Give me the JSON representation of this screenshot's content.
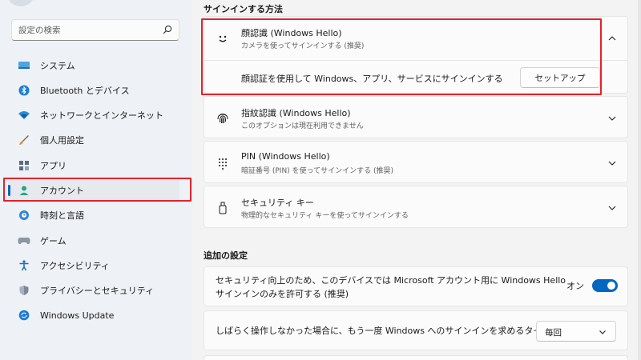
{
  "sidebar": {
    "search_placeholder": "設定の検索",
    "items": [
      {
        "label": "システム",
        "icon": "monitor-icon"
      },
      {
        "label": "Bluetooth とデバイス",
        "icon": "bluetooth-icon"
      },
      {
        "label": "ネットワークとインターネット",
        "icon": "wifi-icon"
      },
      {
        "label": "個人用設定",
        "icon": "brush-icon"
      },
      {
        "label": "アプリ",
        "icon": "apps-icon"
      },
      {
        "label": "アカウント",
        "icon": "person-icon"
      },
      {
        "label": "時刻と言語",
        "icon": "globe-clock-icon"
      },
      {
        "label": "ゲーム",
        "icon": "gamepad-icon"
      },
      {
        "label": "アクセシビリティ",
        "icon": "accessibility-icon"
      },
      {
        "label": "プライバシーとセキュリティ",
        "icon": "shield-icon"
      },
      {
        "label": "Windows Update",
        "icon": "update-icon"
      }
    ]
  },
  "signin": {
    "title": "サインインする方法",
    "face": {
      "title": "顔認識 (Windows Hello)",
      "subtitle": "カメラを使ってサインインする (推奨)",
      "detail": "顔認証を使用して Windows、アプリ、サービスにサインインする",
      "button": "セットアップ"
    },
    "fingerprint": {
      "title": "指紋認識 (Windows Hello)",
      "subtitle": "このオプションは現在利用できません"
    },
    "pin": {
      "title": "PIN (Windows Hello)",
      "subtitle": "暗証番号 (PIN) を使ってサインインする (推奨)"
    },
    "key": {
      "title": "セキュリティ キー",
      "subtitle": "物理的なセキュリティ キーを使ってサインインする"
    }
  },
  "additional": {
    "title": "追加の設定",
    "ms_only": {
      "line1": "セキュリティ向上のため、このデバイスでは Microsoft アカウント用に Windows Hello",
      "line2": "サインインのみを許可する (推奨)",
      "state": "オン"
    },
    "timeout": {
      "label": "しばらく操作しなかった場合に、もう一度 Windows へのサインインを求めるタイミング",
      "value": "毎回"
    }
  },
  "colors": {
    "accent": "#0067c0",
    "highlight": "#e0242b"
  }
}
